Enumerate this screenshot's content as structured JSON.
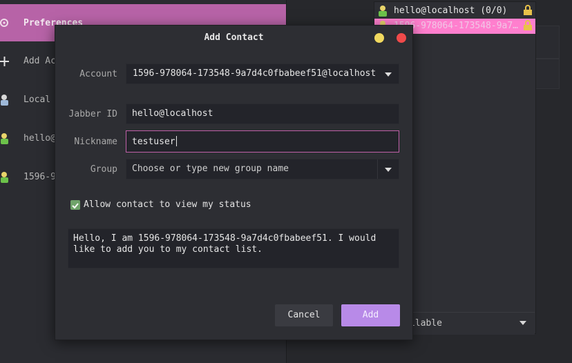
{
  "sidebar": {
    "preferences_label": "Preferences",
    "items": [
      {
        "label": "Add Ac",
        "icon": "plus-icon"
      },
      {
        "label": "Local",
        "icon": "user-icon"
      },
      {
        "label": "hello@",
        "icon": "user-online-icon"
      },
      {
        "label": "1596-9",
        "icon": "user-online-icon"
      }
    ]
  },
  "contact_panel": {
    "rows": [
      {
        "label": "hello@localhost (0/0)"
      },
      {
        "label": "1596-978064-173548-9a7…"
      }
    ],
    "status": "ilable"
  },
  "dialog": {
    "title": "Add Contact",
    "account_label": "Account",
    "account_value": "1596-978064-173548-9a7d4c0fbabeef51@localhost",
    "jid_label": "Jabber ID",
    "jid_value": "hello@localhost",
    "nick_label": "Nickname",
    "nick_value": "testuser",
    "group_label": "Group",
    "group_placeholder": "Choose or type new group name",
    "allow_label": "Allow contact to view my status",
    "allow_checked": true,
    "message": "Hello, I am 1596-978064-173548-9a7d4c0fbabeef51. I would like to add you to my contact list.",
    "cancel_label": "Cancel",
    "add_label": "Add"
  },
  "colors": {
    "accent_pink": "#b763a7",
    "highlight_pink": "#ff7fce",
    "add_button": "#b88ae8",
    "checkbox": "#6fa36a"
  }
}
